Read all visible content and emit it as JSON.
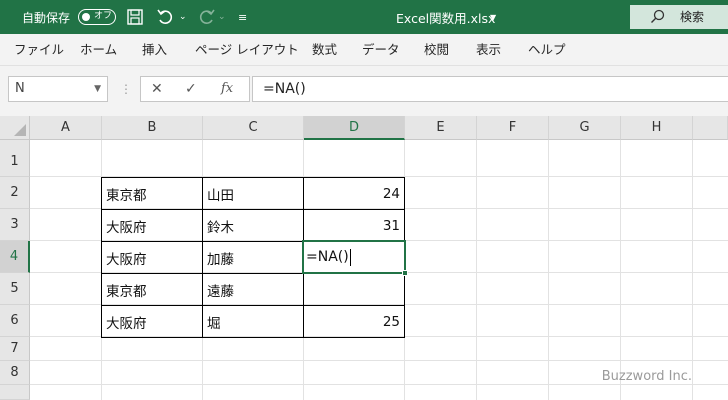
{
  "titlebar": {
    "autosave_label": "自動保存",
    "autosave_state": "オフ",
    "filename": "Excel関数用.xlsx",
    "search_label": "検索",
    "bg_color": "#217346"
  },
  "ribbon": {
    "tabs": [
      "ファイル",
      "ホーム",
      "挿入",
      "ページ レイアウト",
      "数式",
      "データ",
      "校閲",
      "表示",
      "ヘルプ"
    ]
  },
  "formula_bar": {
    "name_box": "N",
    "formula": "=NA()",
    "fx_label": "fx"
  },
  "grid": {
    "columns": [
      "A",
      "B",
      "C",
      "D",
      "E",
      "F",
      "G",
      "H"
    ],
    "rows": [
      "1",
      "2",
      "3",
      "4",
      "5",
      "6",
      "7",
      "8"
    ],
    "selected_column": "D",
    "selected_row": "4",
    "cells": {
      "B2": "東京都",
      "C2": "山田",
      "D2": "24",
      "B3": "大阪府",
      "C3": "鈴木",
      "D3": "31",
      "B4": "大阪府",
      "C4": "加藤",
      "D4": "=NA()",
      "B5": "東京都",
      "C5": "遠藤",
      "D5": "",
      "B6": "大阪府",
      "C6": "堀",
      "D6": "25"
    },
    "active_cell": "D4"
  },
  "watermark": "Buzzword Inc."
}
